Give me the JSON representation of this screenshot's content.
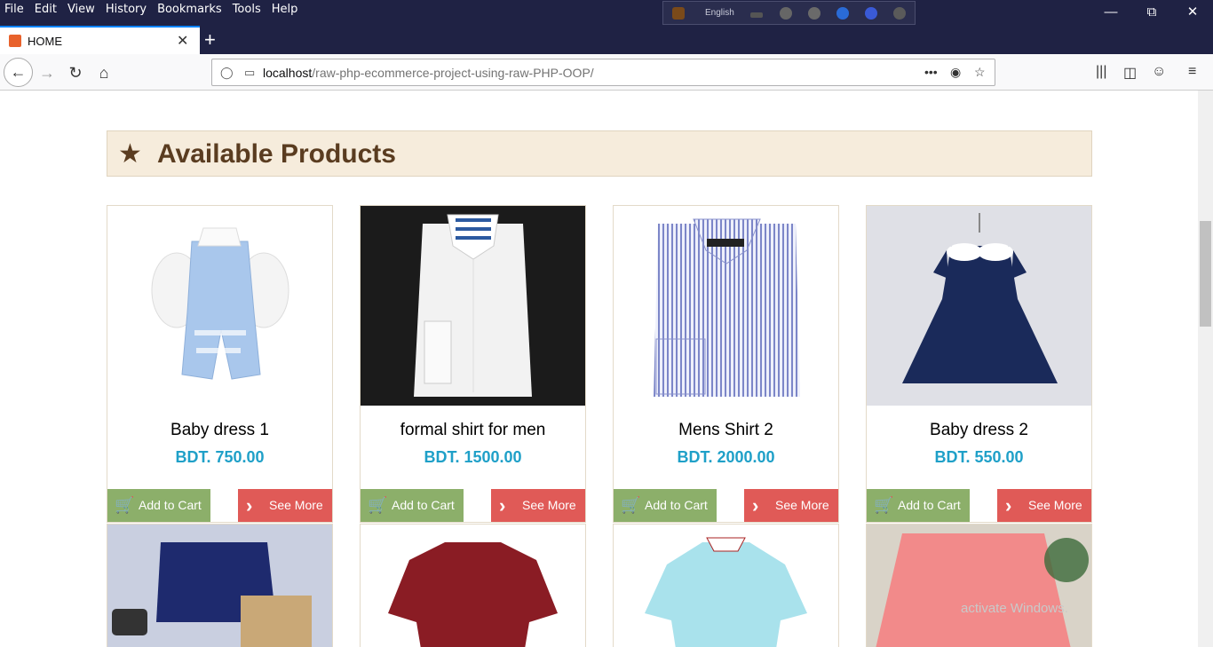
{
  "browser": {
    "menu": [
      "File",
      "Edit",
      "View",
      "History",
      "Bookmarks",
      "Tools",
      "Help"
    ],
    "ime_language": "English",
    "tab_title": "HOME",
    "url_host": "localhost",
    "url_path": "/raw-php-ecommerce-project-using-raw-PHP-OOP/",
    "icons": [
      "back-icon",
      "forward-icon",
      "reload-icon",
      "home-icon",
      "shield-icon",
      "page-icon",
      "more-icon",
      "pocket-icon",
      "bookmark-star-icon",
      "library-icon",
      "sidebar-icon",
      "account-icon",
      "menu-icon"
    ]
  },
  "page": {
    "section_heading": "Available Products",
    "star_glyph": "★",
    "add_to_cart_label": "Add to Cart",
    "see_more_label": "See More",
    "products": [
      {
        "name": "Baby dress 1",
        "price": "BDT. 750.00"
      },
      {
        "name": "formal shirt for men",
        "price": "BDT. 1500.00"
      },
      {
        "name": "Mens Shirt 2",
        "price": "BDT. 2000.00"
      },
      {
        "name": "Baby dress 2",
        "price": "BDT. 550.00"
      }
    ]
  },
  "os": {
    "watermark": "activate Windows."
  },
  "colors": {
    "heading_bg": "#f6ecdc",
    "heading_text": "#5a3c20",
    "price_text": "#1fa0c8",
    "cart_button": "#8caf6a",
    "more_button": "#e05a57",
    "titlebar": "#1f2244"
  }
}
